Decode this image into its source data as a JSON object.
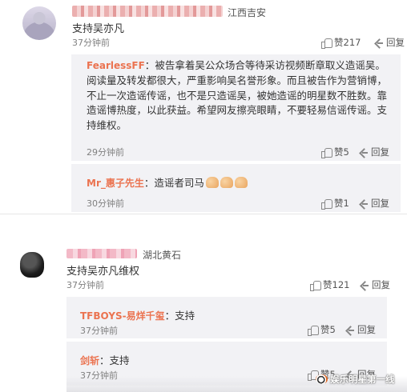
{
  "comment1": {
    "location": "江西吉安",
    "text": "支持吴亦凡",
    "time": "37分钟前",
    "like_label": "赞217",
    "reply_label": "回复",
    "replies": [
      {
        "author": "FearlessFF",
        "text_lines": [
          "被告拿着吴公众场合等待采访视频断章取义造谣",
          "吴。阅读量及转发都很大，严重影响吴名誉形象。而且被告作为",
          "营销博，不止一次造谣传谣，也不是只造谣吴，被她造谣的明星",
          "数不胜数。靠造谣博热度，以此获益。希望网友擦亮眼睛，不要",
          "轻易信谣传谣。支持维权。"
        ],
        "time": "29分钟前",
        "like_label": "赞5",
        "reply_label": "回复"
      },
      {
        "author": "Mr_惠子先生",
        "text": "造谣者司马",
        "time": "30分钟前",
        "like_label": "赞1",
        "reply_label": "回复"
      }
    ]
  },
  "comment2": {
    "location": "湖北黄石",
    "text": "支持吴亦凡维权",
    "time": "37分钟前",
    "like_label": "赞121",
    "reply_label": "回复",
    "replies": [
      {
        "author": "TFBOYS-易烊千玺",
        "text": "支持",
        "time": "37分钟前",
        "like_label": "赞5",
        "reply_label": "回复"
      },
      {
        "author": "剑斩",
        "text": "支持",
        "time": "37分钟前",
        "like_label": "赞5",
        "reply_label": "回复"
      }
    ]
  },
  "watermark": "娱乐明星第一线",
  "colors": {
    "link": "#eb7350",
    "reply_bg": "#f2f2f5"
  }
}
